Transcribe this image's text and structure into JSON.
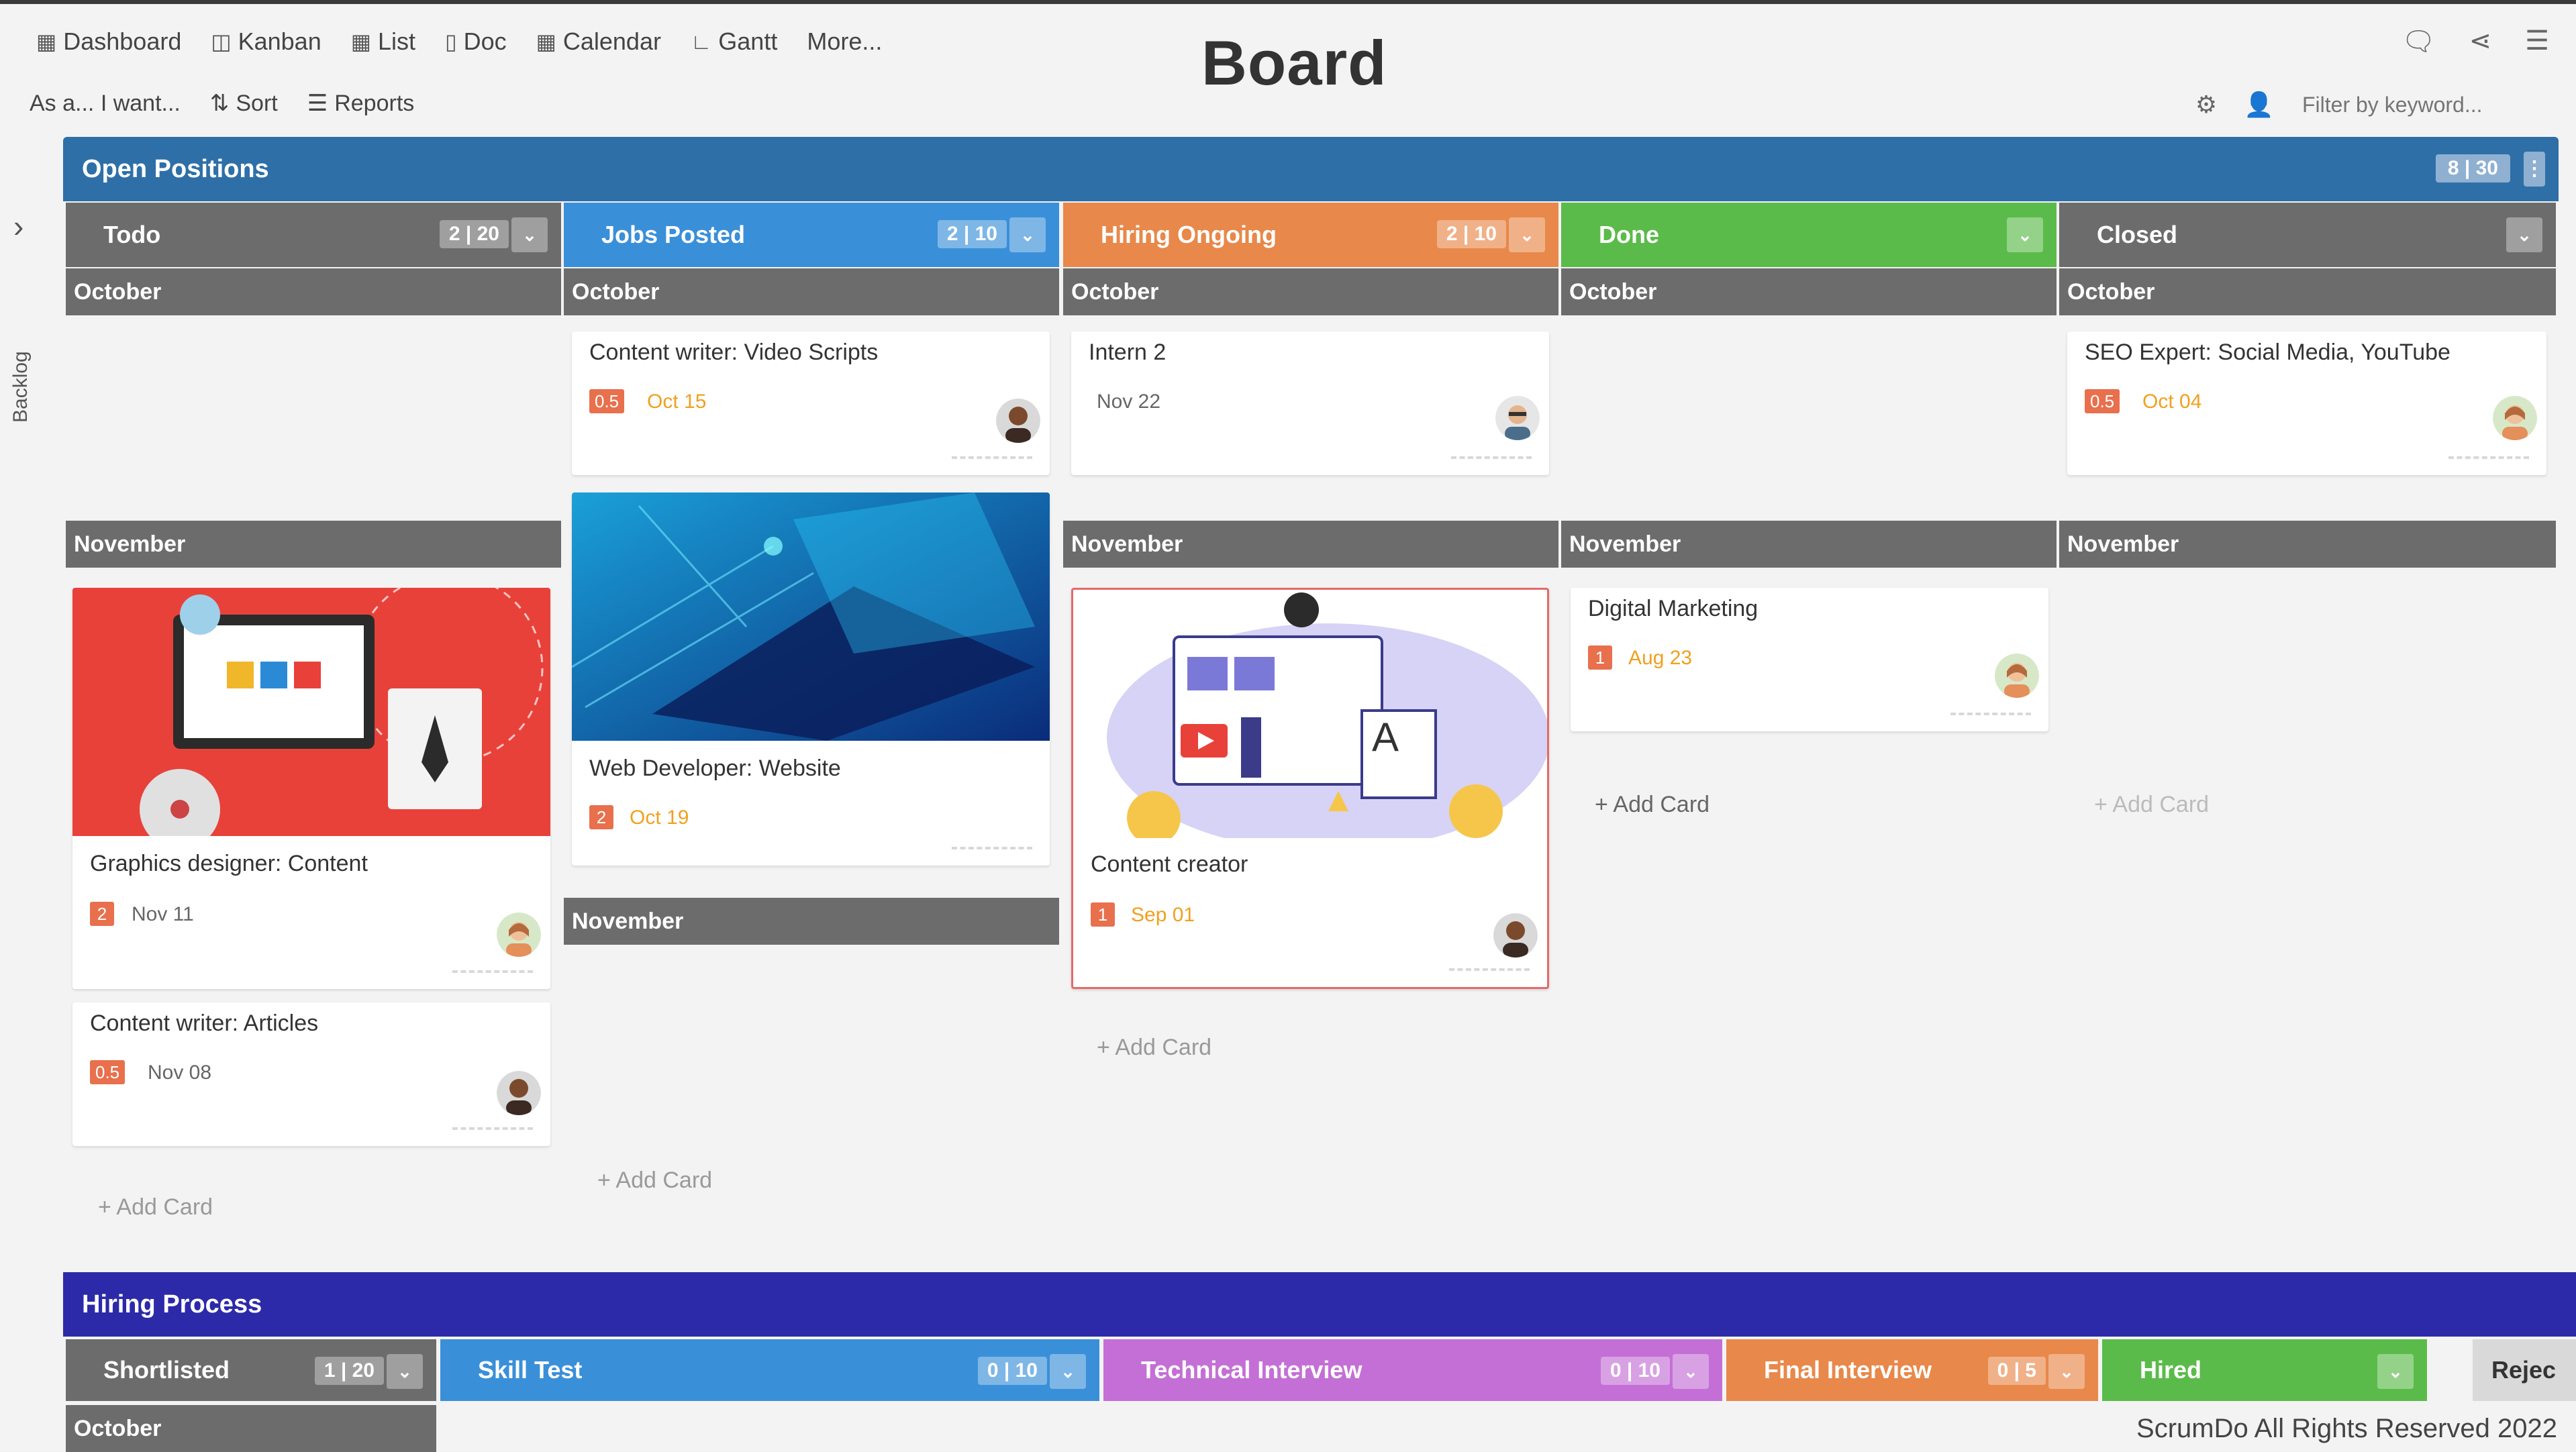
{
  "nav": {
    "items": [
      {
        "label": "Dashboard",
        "icon": "dashboard-icon"
      },
      {
        "label": "Kanban",
        "icon": "kanban-icon"
      },
      {
        "label": "List",
        "icon": "list-icon"
      },
      {
        "label": "Doc",
        "icon": "doc-icon"
      },
      {
        "label": "Calendar",
        "icon": "calendar-icon"
      },
      {
        "label": "Gantt",
        "icon": "gantt-icon"
      },
      {
        "label": "More...",
        "icon": ""
      }
    ],
    "title": "Board"
  },
  "subbar": {
    "story_template": "As a... I want...",
    "sort_label": "Sort",
    "reports_label": "Reports",
    "filter_placeholder": "Filter by keyword..."
  },
  "rail": {
    "backlog_label": "Backlog"
  },
  "lane1": {
    "title": "Open Positions",
    "count": "8 | 30",
    "columns": [
      {
        "name": "Todo",
        "count": "2 | 20",
        "color": "#6c6c6c"
      },
      {
        "name": "Jobs Posted",
        "count": "2 | 10",
        "color": "#3a8fd9"
      },
      {
        "name": "Hiring Ongoing",
        "count": "2 | 10",
        "color": "#e8884a"
      },
      {
        "name": "Done",
        "count": "",
        "color": "#5bbb4a"
      },
      {
        "name": "Closed",
        "count": "",
        "color": "#6c6c6c"
      }
    ],
    "months": {
      "october": "October",
      "november": "November"
    },
    "cards": {
      "video_scripts": {
        "title": "Content writer: Video Scripts",
        "points": "0.5",
        "date": "Oct 15"
      },
      "intern": {
        "title": "Intern 2",
        "date": "Nov 22"
      },
      "seo": {
        "title": "SEO Expert: Social Media, YouTube",
        "points": "0.5",
        "date": "Oct 04"
      },
      "web_dev": {
        "title": "Web Developer: Website",
        "points": "2",
        "date": "Oct 19"
      },
      "graphics": {
        "title": "Graphics designer: Content",
        "points": "2",
        "date": "Nov 11"
      },
      "articles": {
        "title": "Content writer: Articles",
        "points": "0.5",
        "date": "Nov 08"
      },
      "creator": {
        "title": "Content creator",
        "points": "1",
        "date": "Sep 01"
      },
      "marketing": {
        "title": "Digital Marketing",
        "points": "1",
        "date": "Aug 23"
      }
    },
    "add_card": "+ Add Card"
  },
  "lane2": {
    "title": "Hiring Process",
    "columns": [
      {
        "name": "Shortlisted",
        "count": "1 | 20",
        "color": "#6c6c6c"
      },
      {
        "name": "Skill Test",
        "count": "0 | 10",
        "color": "#3a8fd9"
      },
      {
        "name": "Technical Interview",
        "count": "0 | 10",
        "color": "#c46fd6"
      },
      {
        "name": "Final Interview",
        "count": "0 | 5",
        "color": "#e8884a"
      },
      {
        "name": "Hired",
        "count": "",
        "color": "#5bbb4a"
      },
      {
        "name": "Rejec",
        "count": "",
        "color": "#9a9a9a"
      }
    ],
    "month": "October"
  },
  "footer": "ScrumDo All Rights Reserved 2022"
}
